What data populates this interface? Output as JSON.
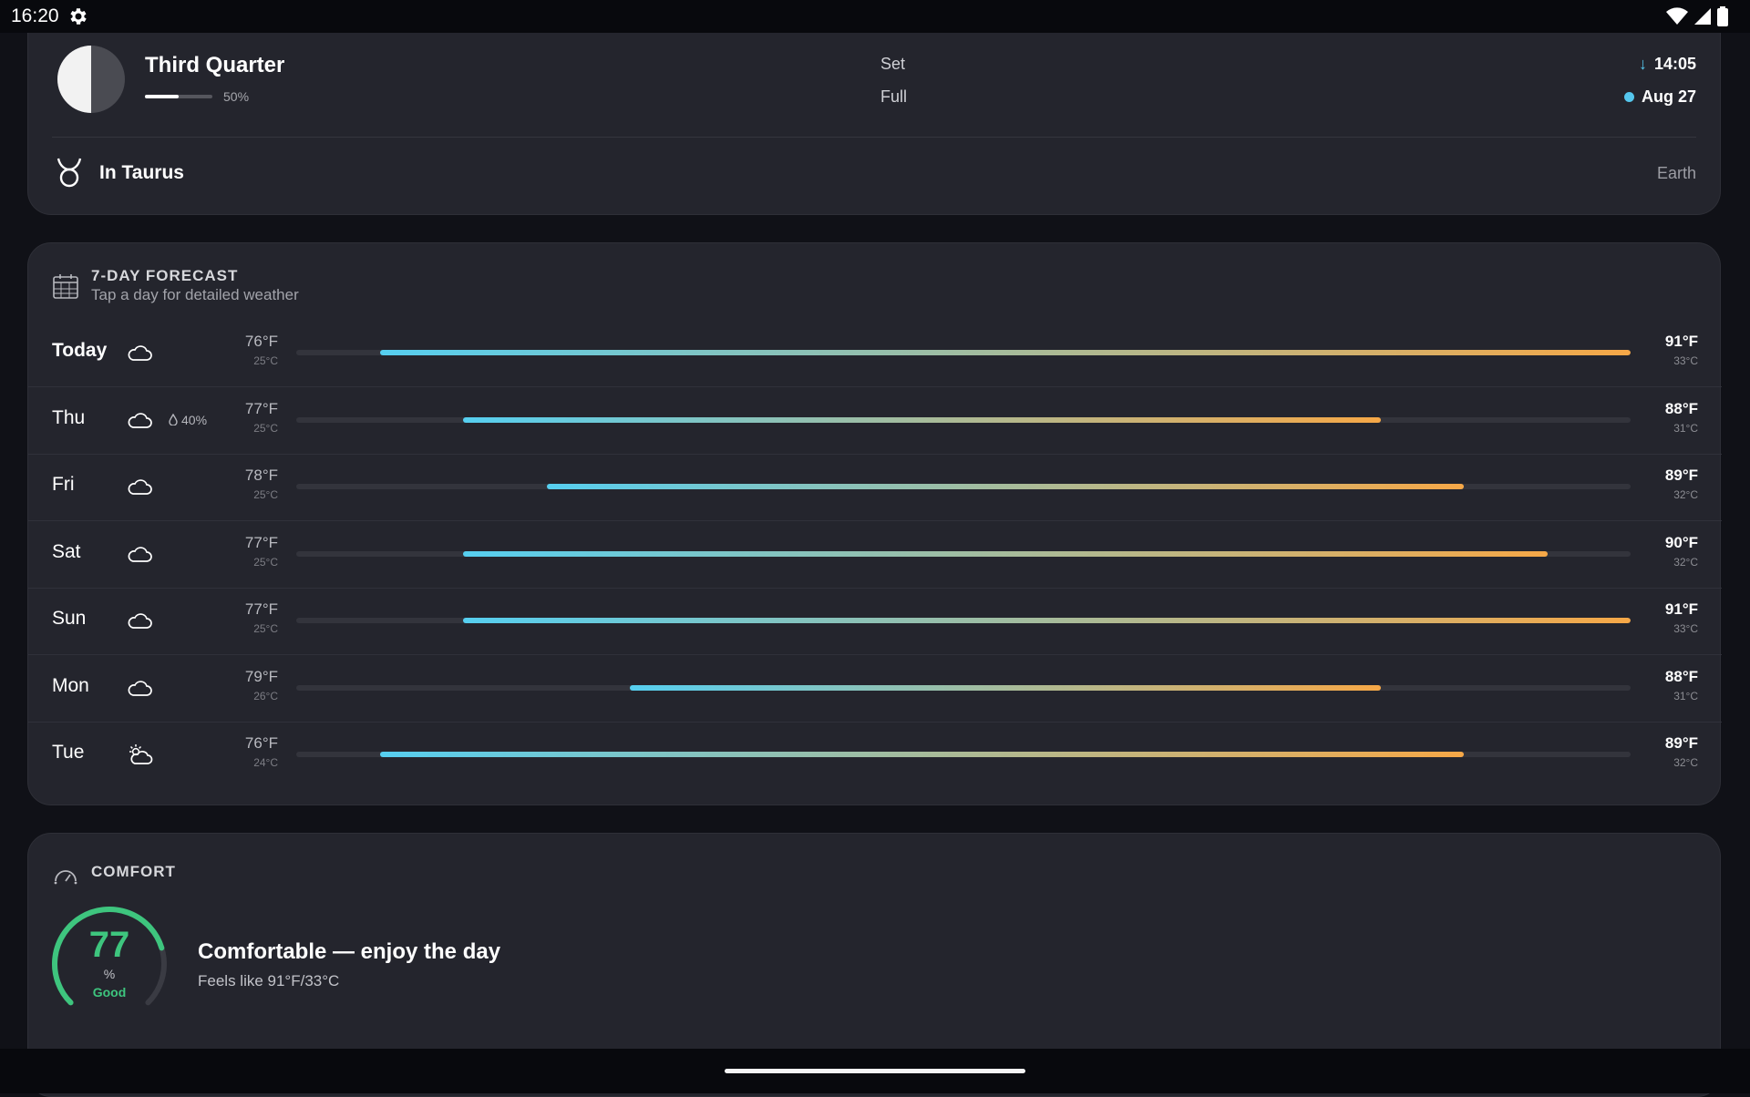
{
  "status_bar": {
    "time": "16:20"
  },
  "moon": {
    "phase": "Third Quarter",
    "illumination_percent": 50,
    "illumination_label": "50%",
    "set_label": "Set",
    "set_time": "14:05",
    "full_label": "Full",
    "full_date": "Aug 27",
    "zodiac": "In Taurus",
    "element": "Earth"
  },
  "forecast": {
    "title": "7-DAY FORECAST",
    "subtitle": "Tap a day for detailed weather",
    "range_min_f": 75,
    "range_max_f": 91,
    "days": [
      {
        "day": "Today",
        "icon": "cloud-icon",
        "precip": "",
        "low_f": "76°F",
        "low_c": "25°C",
        "high_f": "91°F",
        "high_c": "33°C",
        "low": 76,
        "high": 91
      },
      {
        "day": "Thu",
        "icon": "cloud-icon",
        "precip": "40%",
        "low_f": "77°F",
        "low_c": "25°C",
        "high_f": "88°F",
        "high_c": "31°C",
        "low": 77,
        "high": 88
      },
      {
        "day": "Fri",
        "icon": "cloud-icon",
        "precip": "",
        "low_f": "78°F",
        "low_c": "25°C",
        "high_f": "89°F",
        "high_c": "32°C",
        "low": 78,
        "high": 89
      },
      {
        "day": "Sat",
        "icon": "cloud-icon",
        "precip": "",
        "low_f": "77°F",
        "low_c": "25°C",
        "high_f": "90°F",
        "high_c": "32°C",
        "low": 77,
        "high": 90
      },
      {
        "day": "Sun",
        "icon": "cloud-icon",
        "precip": "",
        "low_f": "77°F",
        "low_c": "25°C",
        "high_f": "91°F",
        "high_c": "33°C",
        "low": 77,
        "high": 91
      },
      {
        "day": "Mon",
        "icon": "cloud-icon",
        "precip": "",
        "low_f": "79°F",
        "low_c": "26°C",
        "high_f": "88°F",
        "high_c": "31°C",
        "low": 79,
        "high": 88
      },
      {
        "day": "Tue",
        "icon": "partly-cloudy-icon",
        "precip": "",
        "low_f": "76°F",
        "low_c": "24°C",
        "high_f": "89°F",
        "high_c": "32°C",
        "low": 76,
        "high": 89
      }
    ]
  },
  "comfort": {
    "title": "COMFORT",
    "score": "77",
    "score_value": 77,
    "unit": "%",
    "rating": "Good",
    "headline": "Comfortable — enjoy the day",
    "feels_like": "Feels like 91°F/33°C"
  },
  "colors": {
    "bar_cold": "#56cff0",
    "bar_warm": "#f6a847",
    "comfort_green": "#3ec57e",
    "full_moon_dot": "#55c7ee"
  }
}
